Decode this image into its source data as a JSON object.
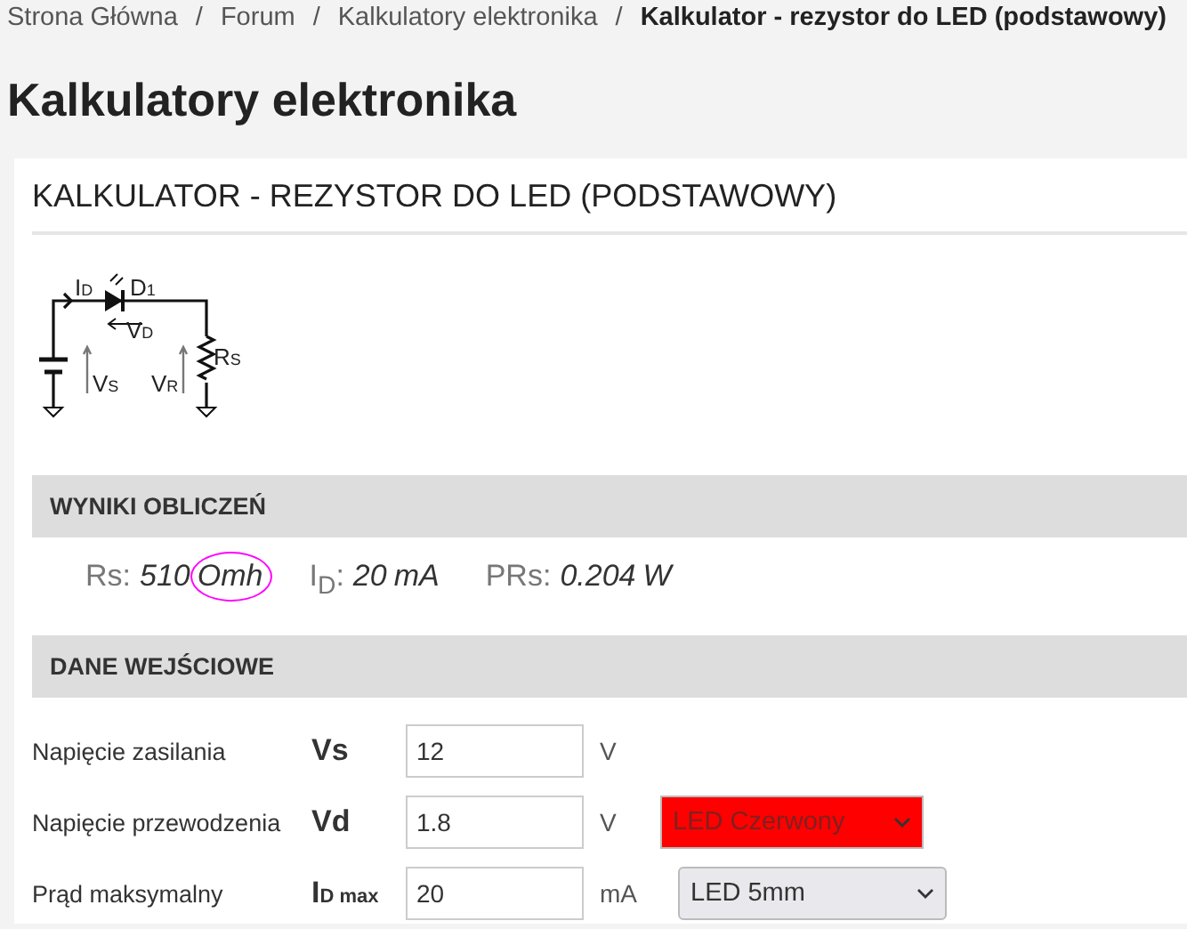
{
  "breadcrumb": [
    {
      "label": "Strona Główna",
      "current": false
    },
    {
      "label": "Forum",
      "current": false
    },
    {
      "label": "Kalkulatory elektronika",
      "current": false
    },
    {
      "label": "Kalkulator - rezystor do LED (podstawowy)",
      "current": true
    }
  ],
  "breadcrumb_separator": "/",
  "page_title": "Kalkulatory elektronika",
  "card": {
    "title": "KALKULATOR - REZYSTOR DO LED (PODSTAWOWY)",
    "circuit": {
      "labels": [
        {
          "main": "I",
          "sub": "D"
        },
        {
          "main": "D",
          "sub": "1"
        },
        {
          "main": "V",
          "sub": "D"
        },
        {
          "main": "V",
          "sub": "S"
        },
        {
          "main": "V",
          "sub": "R"
        },
        {
          "main": "R",
          "sub": "S"
        }
      ]
    },
    "results": {
      "title": "WYNIKI OBLICZEŃ",
      "items": [
        {
          "label": "Rs:",
          "value": "510",
          "unit": "Omh",
          "circled": true
        },
        {
          "label": "I$_{D}$:",
          "value": "20",
          "unit": "mA",
          "circled": false
        },
        {
          "label": "PRs:",
          "value": "0.204",
          "unit": "W",
          "circled": false
        }
      ]
    },
    "inputs": {
      "title": "DANE WEJŚCIOWE",
      "rows": [
        {
          "label": "Napięcie zasilania",
          "symbol": "Vs",
          "value": "12",
          "unit": "V"
        },
        {
          "label": "Napięcie przewodzenia",
          "symbol": "Vd",
          "value": "1.8",
          "unit": "V",
          "select": {
            "value": "LED Czerwony",
            "color": "#ff0000"
          }
        },
        {
          "label": "Prąd maksymalny",
          "symbol": "I$_{D max}$",
          "value": "20",
          "unit": "mA",
          "select": {
            "value": "LED 5mm"
          }
        }
      ]
    }
  }
}
